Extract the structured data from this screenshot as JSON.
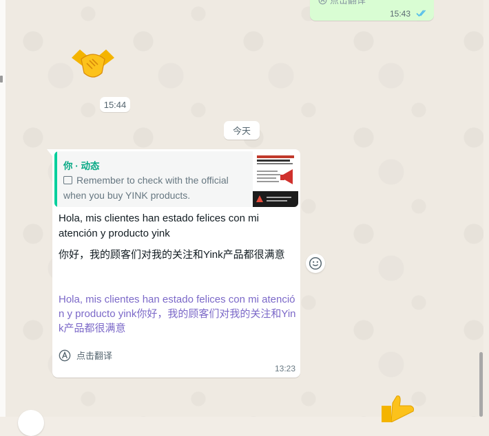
{
  "outgoing_top": {
    "hint_label": "点击翻译",
    "time": "15:43"
  },
  "sticker_handshake": {
    "emoji": "🤝",
    "time": "15:44"
  },
  "date_separator": "今天",
  "incoming_message": {
    "quoted": {
      "author": "你 · 动态",
      "text": "Remember to check with the official when you buy YINK products."
    },
    "text_es": "Hola, mis clientes han estado felices con mi atención y producto yink",
    "text_zh": "你好，我的顾客们对我的关注和Yink产品都很满意",
    "translated_text": "Hola, mis clientes han estado felices con mi atención y producto yink你好，我的顾客们对我的关注和Yink产品都很满意",
    "translate_button_label": "点击翻译",
    "time": "13:23"
  },
  "icons": {
    "read_receipt": "double-check-icon",
    "translate": "translate-icon",
    "reaction": "smiley-icon",
    "image": "image-icon"
  },
  "colors": {
    "chat_background": "#efeae2",
    "outgoing_bubble": "#d9fdd3",
    "quote_bar": "#06cf9c",
    "translated_text": "#7b68c8",
    "read_tick": "#53bdeb"
  }
}
